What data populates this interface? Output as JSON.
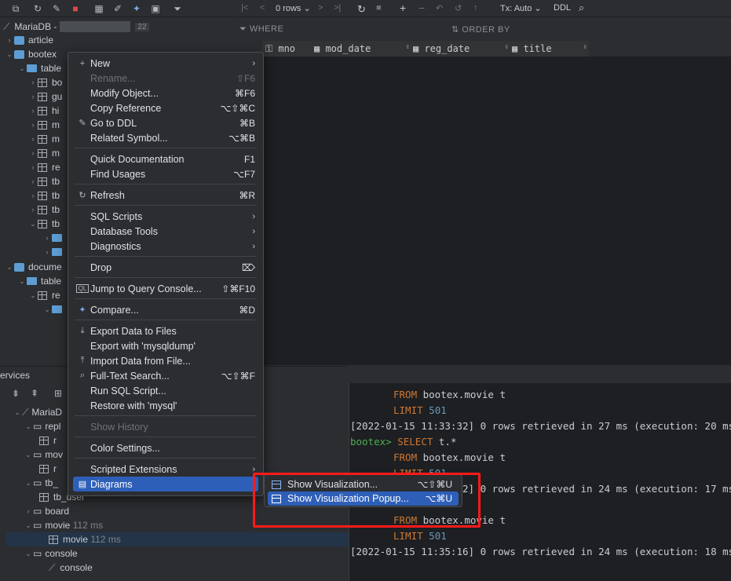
{
  "left_toolbar": {
    "icons": [
      "copy-icon",
      "refresh-icon",
      "edit-icon",
      "stop-icon",
      "table-icon",
      "pencil-icon",
      "jump-icon",
      "console-icon",
      "filter-icon"
    ]
  },
  "grid_toolbar": {
    "rows": "0 rows",
    "tx": "Tx: Auto",
    "ddl": "DDL"
  },
  "filter_bar": {
    "where": "WHERE",
    "order_by": "ORDER BY"
  },
  "columns": [
    "mno",
    "mod_date",
    "reg_date",
    "title"
  ],
  "tree": {
    "connection": "MariaDB - ",
    "connection_badge": "22",
    "article": "article",
    "bootex": "bootex",
    "tables_label": "table",
    "table_items": [
      "bo",
      "gu",
      "hi",
      "m",
      "m",
      "m",
      "re",
      "tb",
      "tb",
      "tb",
      "tb"
    ],
    "document": "docume",
    "doc_tables": "table",
    "doc_re": "re"
  },
  "services": {
    "title": "ervices",
    "mariadb": "MariaD",
    "repl": "repl",
    "r1": "r",
    "mov": "mov",
    "r2": "r",
    "tb_u": "tb_",
    "tb_user": "tb_user",
    "board": "board",
    "movie": "movie",
    "movie_time": "112 ms",
    "movie_child": "movie",
    "movie_child_time": "112 ms",
    "console": "console",
    "console_child": "console"
  },
  "console_lines": [
    {
      "indent": true,
      "kw": "FROM",
      "rest": " bootex.movie t"
    },
    {
      "indent": true,
      "kw": "LIMIT",
      "num": " 501"
    },
    {
      "text": "[2022-01-15 11:33:32] 0 rows retrieved in 27 ms (execution: 20 ms, fe"
    },
    {
      "prompt": "bootex>",
      "kw": " SELECT",
      "rest": " t.*"
    },
    {
      "indent": true,
      "kw": "FROM",
      "rest": " bootex.movie t"
    },
    {
      "indent": true,
      "kw": "LIMIT",
      "num": " 501"
    },
    {
      "text": "[2022-01-15 11:33:32] 0 rows retrieved in 24 ms (execution: 17 ms, fe"
    },
    {
      "indent": true,
      "kw": "",
      "rest": ""
    },
    {
      "indent": true,
      "kw": "FROM",
      "rest": " bootex.movie t"
    },
    {
      "indent": true,
      "kw": "LIMIT",
      "num": " 501"
    },
    {
      "text": "[2022-01-15 11:35:16] 0 rows retrieved in 24 ms (execution: 18 ms, fe"
    }
  ],
  "context_menu": {
    "items": [
      {
        "label": "New",
        "icon": "+",
        "submenu": true
      },
      {
        "label": "Rename...",
        "shortcut": "⇧F6",
        "disabled": true
      },
      {
        "label": "Modify Object...",
        "shortcut": "⌘F6"
      },
      {
        "label": "Copy Reference",
        "shortcut": "⌥⇧⌘C"
      },
      {
        "label": "Go to DDL",
        "icon": "✎",
        "shortcut": "⌘B"
      },
      {
        "label": "Related Symbol...",
        "shortcut": "⌥⌘B"
      },
      {
        "label": "Quick Documentation",
        "shortcut": "F1"
      },
      {
        "label": "Find Usages",
        "shortcut": "⌥F7"
      },
      {
        "label": "Refresh",
        "icon": "↻",
        "shortcut": "⌘R"
      },
      {
        "label": "SQL Scripts",
        "submenu": true
      },
      {
        "label": "Database Tools",
        "submenu": true
      },
      {
        "label": "Diagnostics",
        "submenu": true
      },
      {
        "label": "Drop",
        "icon_right": "⌦"
      },
      {
        "label": "Jump to Query Console...",
        "icon": "QL",
        "shortcut": "⇧⌘F10"
      },
      {
        "label": "Compare...",
        "icon": "✦",
        "shortcut": "⌘D"
      },
      {
        "label": "Export Data to Files",
        "icon": "⤓"
      },
      {
        "label": "Export with 'mysqldump'"
      },
      {
        "label": "Import Data from File...",
        "icon": "⤒"
      },
      {
        "label": "Full-Text Search...",
        "icon": "⌕",
        "shortcut": "⌥⇧⌘F"
      },
      {
        "label": "Run SQL Script..."
      },
      {
        "label": "Restore with 'mysql'"
      },
      {
        "label": "Show History",
        "disabled": true
      },
      {
        "label": "Color Settings..."
      },
      {
        "label": "Scripted Extensions",
        "submenu": true
      },
      {
        "label": "Diagrams",
        "submenu": true,
        "active": true
      }
    ]
  },
  "submenu": {
    "items": [
      {
        "label": "Show Visualization...",
        "shortcut": "⌥⇧⌘U"
      },
      {
        "label": "Show Visualization Popup...",
        "shortcut": "⌥⌘U",
        "active": true
      }
    ]
  },
  "colors": {
    "accent": "#2e5fb8",
    "highlight": "#ff1a1a",
    "keyword": "#cc7832",
    "number": "#6897bb",
    "prompt": "#4caf50"
  }
}
